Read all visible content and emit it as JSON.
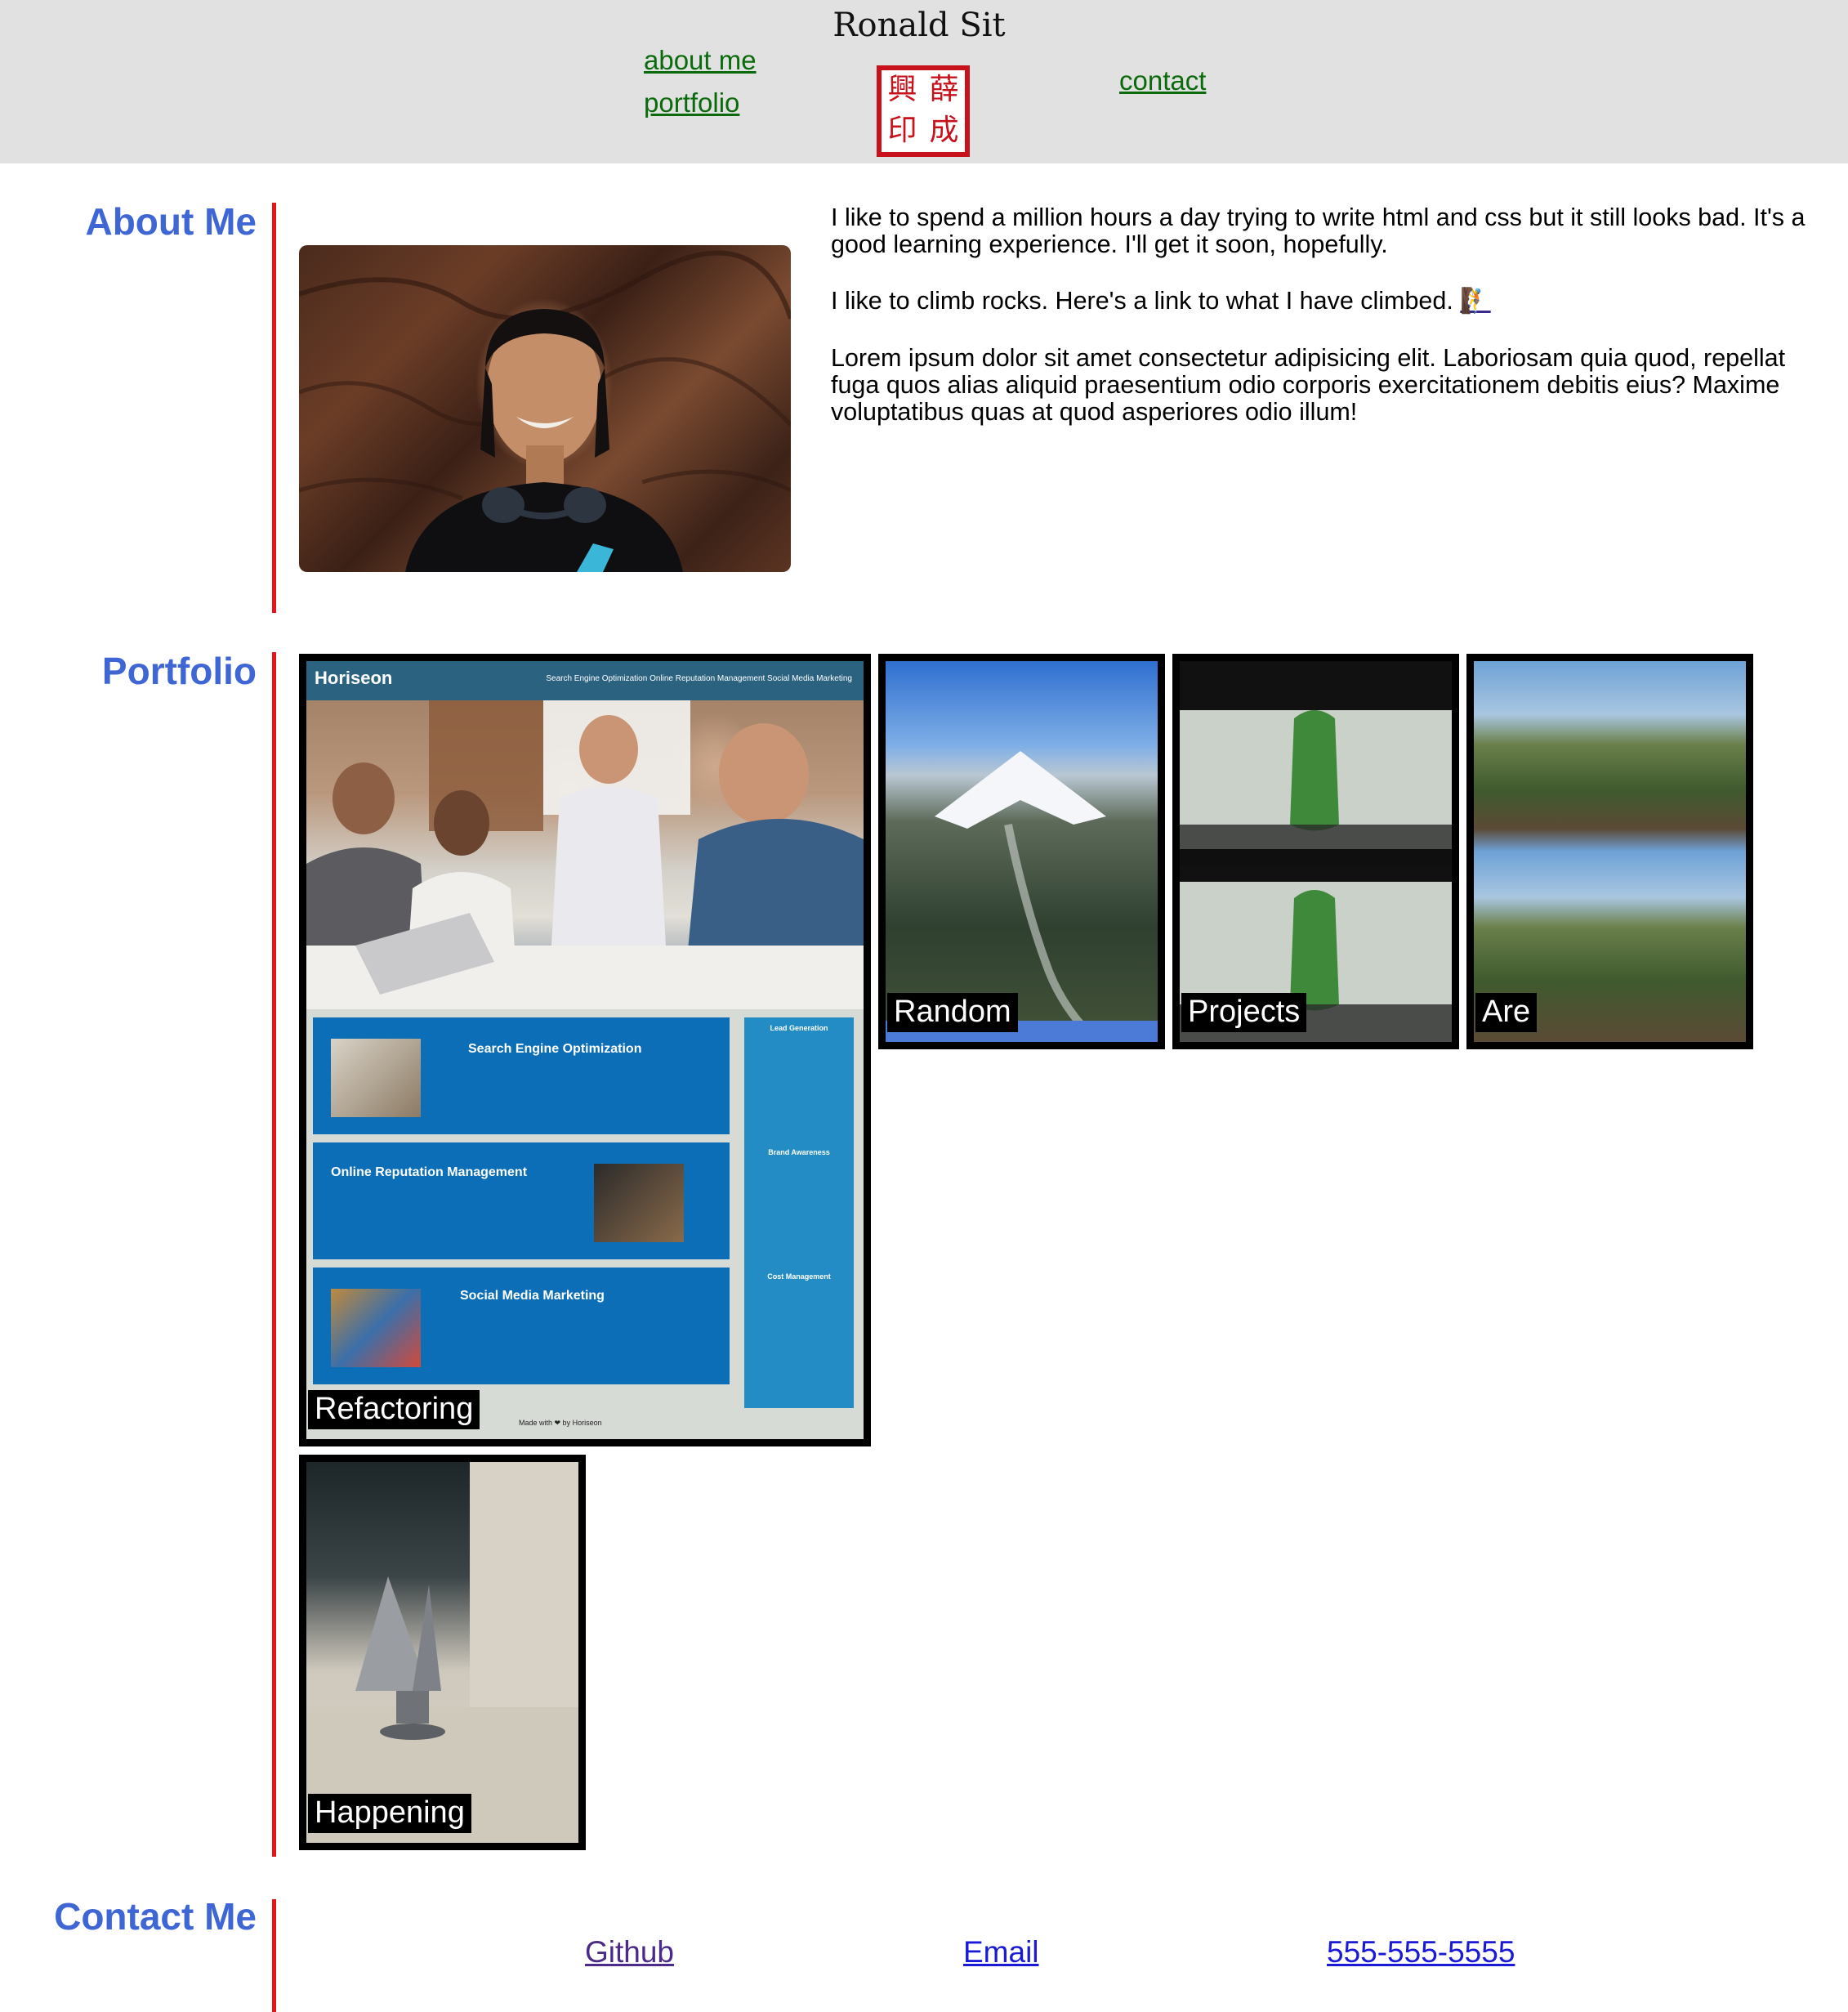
{
  "header": {
    "site_name": "Ronald Sit",
    "nav": {
      "about": "about me",
      "portfolio": "portfolio",
      "contact": "contact"
    },
    "seal_chars": [
      "興",
      "薛",
      "印",
      "成"
    ]
  },
  "about": {
    "title": "About Me",
    "paragraph1": "I like to spend a million hours a day trying to write html and css but it still looks bad. It's a good learning experience. I'll get it soon, hopefully.",
    "paragraph2": "I like to climb rocks. Here's a link to what I have climbed.",
    "paragraph3": "Lorem ipsum dolor sit amet consectetur adipisicing elit. Laboriosam quia quod, repellat fuga quos alias aliquid praesentium odio corporis exercitationem debitis eius? Maxime voluptatibus quas at quod asperiores odio illum!"
  },
  "portfolio": {
    "title": "Portfolio",
    "tiles": [
      "Refactoring",
      "Random",
      "Projects",
      "Are",
      "Happening"
    ],
    "horiseon": {
      "logo": "Horiseon",
      "nav": "Search Engine Optimization    Online Reputation Management    Social Media Marketing",
      "cards": [
        "Search Engine Optimization",
        "Online Reputation Management",
        "Social Media Marketing"
      ],
      "sidebar": [
        "Lead Generation",
        "Brand Awareness",
        "Cost Management"
      ],
      "footer": "Made with ❤ by Horiseon"
    }
  },
  "contact": {
    "title": "Contact Me",
    "links": {
      "github": "Github",
      "email": "Email",
      "phone": "555-555-5555"
    }
  },
  "colors": {
    "accent_title": "#3f66d5",
    "bar": "#e8141b",
    "nav_link": "#0b6a0b",
    "header_bg": "#e1e1e1"
  }
}
